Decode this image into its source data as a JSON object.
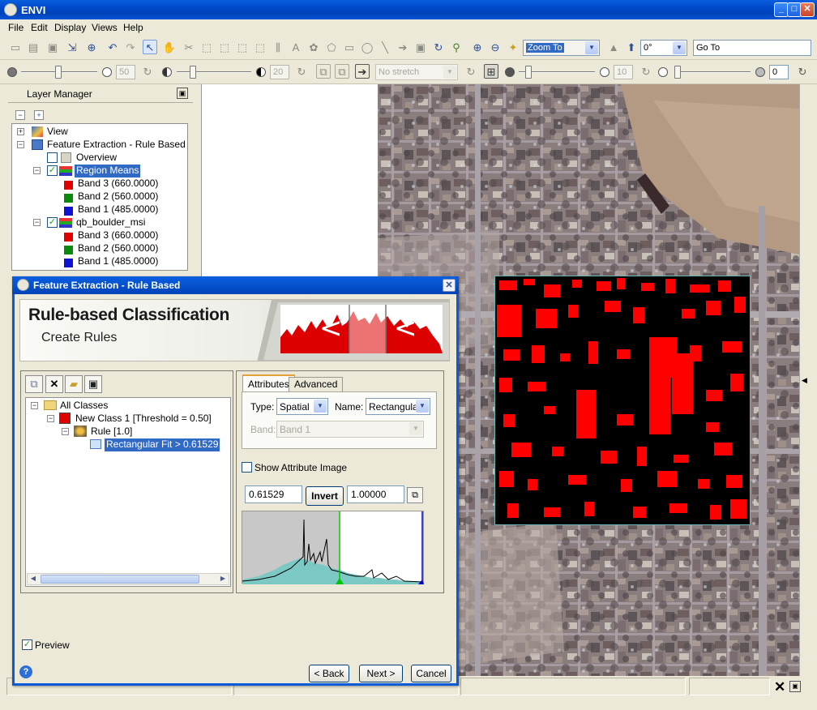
{
  "app": {
    "title": "ENVI",
    "menu": [
      "File",
      "Edit",
      "Display",
      "Views",
      "Help"
    ]
  },
  "toolbar": {
    "zoom_combo": "Zoom To",
    "rotation_combo": "0°",
    "goto_field": "Go To",
    "brightness_value": "50",
    "contrast_value": "20",
    "stretch_combo": "No stretch",
    "sharpen_value": "10",
    "transparency_value": "0"
  },
  "layer_manager": {
    "title": "Layer Manager",
    "items": [
      {
        "label": "View"
      },
      {
        "label": "Feature Extraction - Rule Based"
      },
      {
        "label": "Overview",
        "checked": false
      },
      {
        "label": "Region Means",
        "checked": true,
        "selected": true
      },
      {
        "label": "Band 3 (660.0000)",
        "color": "#e00000"
      },
      {
        "label": "Band 2 (560.0000)",
        "color": "#0a8a0a"
      },
      {
        "label": "Band 1 (485.0000)",
        "color": "#1010d0"
      },
      {
        "label": "qb_boulder_msi",
        "checked": true
      },
      {
        "label": "Band 3 (660.0000)",
        "color": "#e00000"
      },
      {
        "label": "Band 2 (560.0000)",
        "color": "#0a8a0a"
      },
      {
        "label": "Band 1 (485.0000)",
        "color": "#1010d0"
      }
    ]
  },
  "dialog": {
    "title": "Feature Extraction - Rule Based",
    "banner_title": "Rule-based Classification",
    "banner_subtitle": "Create Rules",
    "tree": {
      "root": "All Classes",
      "class": "New Class 1 [Threshold = 0.50]",
      "class_color": "#e00000",
      "rule": "Rule [1.0]",
      "attribute": "Rectangular Fit > 0.61529"
    },
    "tabs": [
      "Attributes",
      "Advanced"
    ],
    "type_label": "Type:",
    "type_value": "Spatial",
    "name_label": "Name:",
    "name_value": "Rectangula",
    "band_label": "Band:",
    "band_value": "Band 1",
    "show_attribute_label": "Show Attribute Image",
    "min_value": "0.61529",
    "invert_label": "Invert",
    "max_value": "1.00000",
    "preview_label": "Preview",
    "back_label": "< Back",
    "next_label": "Next >",
    "cancel_label": "Cancel",
    "help_label": "?"
  },
  "colors": {
    "titlebar": "#0a5ad8",
    "selection": "#316ac5",
    "mask_red": "#ff0000",
    "histogram_fill": "#7cc8c4"
  }
}
